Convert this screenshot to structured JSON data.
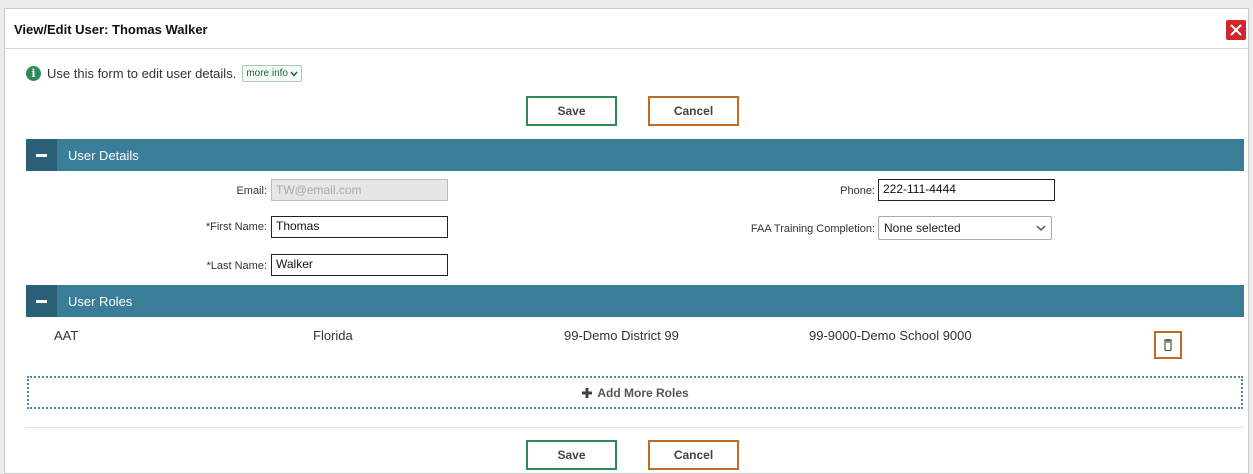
{
  "dialog": {
    "title": "View/Edit User: Thomas Walker",
    "info_text": "Use this form to edit user details.",
    "more_info_label": "more info"
  },
  "actions": {
    "save_label": "Save",
    "cancel_label": "Cancel"
  },
  "user_details": {
    "section_label": "User Details",
    "email_label": "Email:",
    "email_value": "TW@email.com",
    "first_name_label": "*First Name:",
    "first_name_value": "Thomas",
    "last_name_label": "*Last Name:",
    "last_name_value": "Walker",
    "phone_label": "Phone:",
    "phone_value": "222-111-4444",
    "faa_label": "FAA Training Completion:",
    "faa_value": "None selected"
  },
  "user_roles": {
    "section_label": "User Roles",
    "rows": [
      {
        "role": "AAT",
        "state": "Florida",
        "district": "99-Demo District 99",
        "school": "99-9000-Demo School 9000"
      }
    ],
    "add_label": "Add More Roles"
  },
  "colors": {
    "save_border": "#2e8b57",
    "cancel_border": "#c46a29",
    "section_bar": "#3a7d99",
    "close_button": "#d1262c"
  },
  "icons": [
    "close-icon",
    "info-icon",
    "chevron-down-icon",
    "collapse-icon",
    "trash-icon",
    "plus-icon"
  ]
}
